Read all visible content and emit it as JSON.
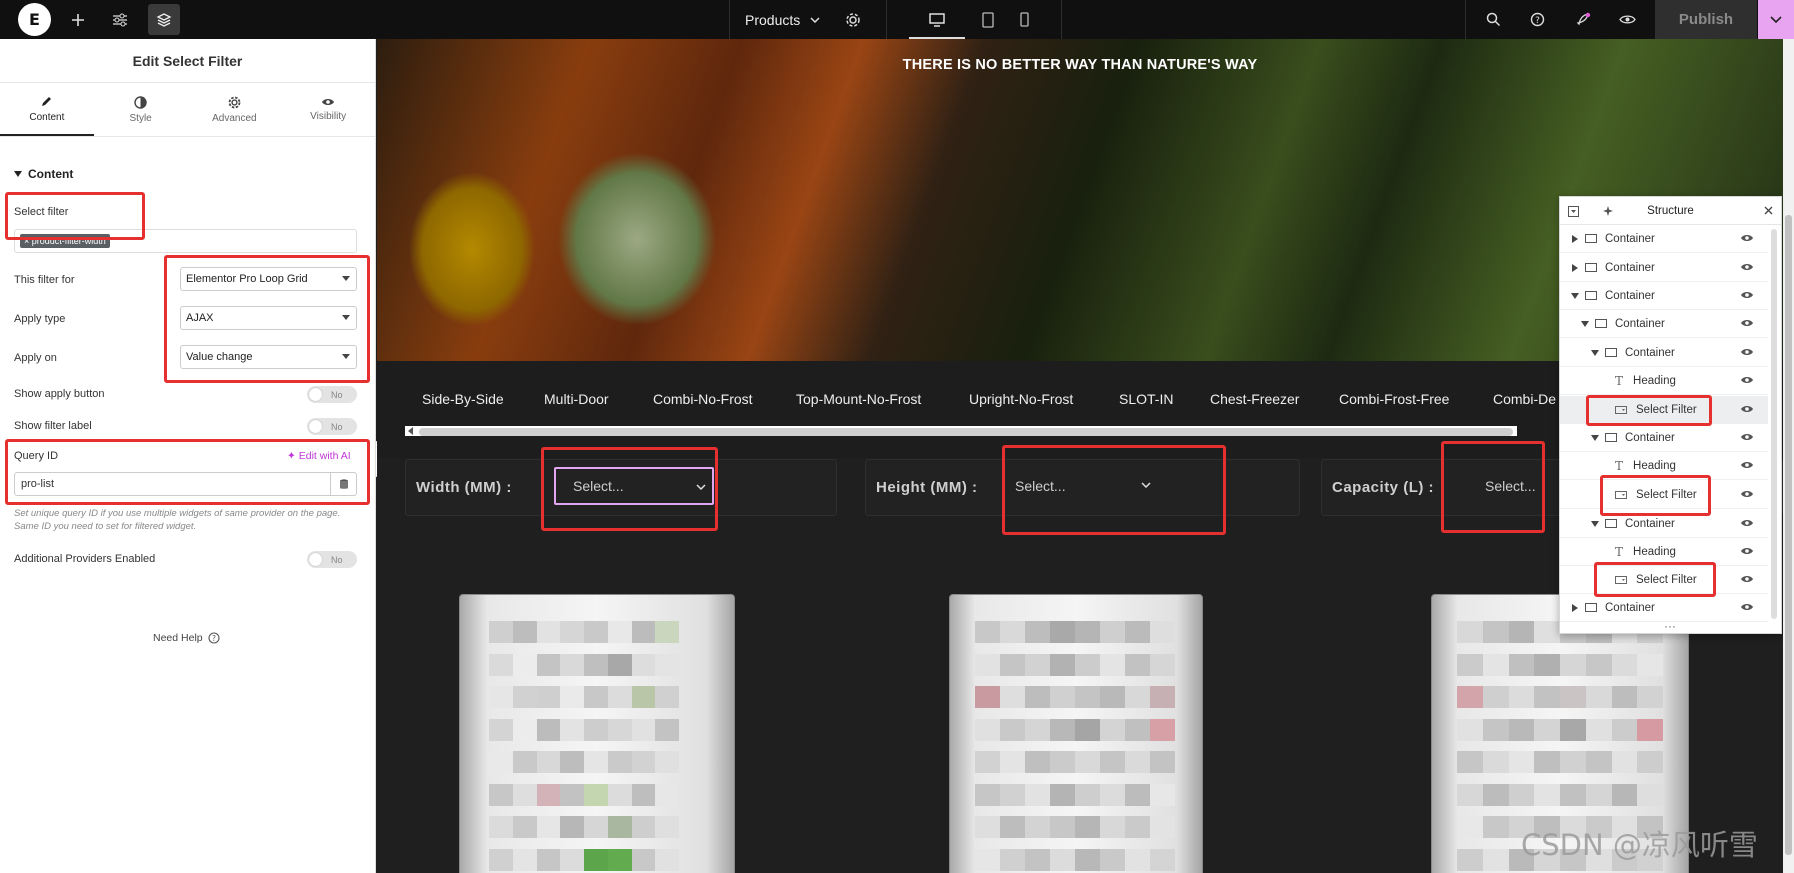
{
  "topbar": {
    "logo_letter": "E",
    "document_name": "Products",
    "publish_label": "Publish",
    "icons": [
      "plus-icon",
      "sliders-icon",
      "layers-icon",
      "chevron-down-icon",
      "gear-icon",
      "desktop-icon",
      "tablet-icon",
      "mobile-icon",
      "search-icon",
      "help-icon",
      "rocket-icon",
      "eye-icon"
    ]
  },
  "panel": {
    "title": "Edit Select Filter",
    "tabs": [
      {
        "label": "Content",
        "icon": "pencil-icon"
      },
      {
        "label": "Style",
        "icon": "half-circle-icon"
      },
      {
        "label": "Advanced",
        "icon": "gear-icon"
      },
      {
        "label": "Visibility",
        "icon": "eye-icon"
      }
    ],
    "section": "Content",
    "select_filter_label": "Select filter",
    "select_filter_tag": "× product-filter-width",
    "filter_for_label": "This filter for",
    "filter_for_value": "Elementor Pro Loop Grid",
    "apply_type_label": "Apply type",
    "apply_type_value": "AJAX",
    "apply_on_label": "Apply on",
    "apply_on_value": "Value change",
    "show_apply_label": "Show apply button",
    "show_apply_value": "No",
    "show_filter_label_label": "Show filter label",
    "show_filter_label_value": "No",
    "query_id_label": "Query ID",
    "edit_with_ai": "Edit with AI",
    "query_id_value": "pro-list",
    "query_note": "Set unique query ID if you use multiple widgets of same provider on the page. Same ID you need to set for filtered widget.",
    "additional_label": "Additional Providers Enabled",
    "additional_value": "No",
    "need_help": "Need Help"
  },
  "canvas": {
    "hero_title": "THERE IS NO BETTER WAY THAN NATURE'S WAY",
    "nav_items": [
      "Side-By-Side",
      "Multi-Door",
      "Combi-No-Frost",
      "Top-Mount-No-Frost",
      "Upright-No-Frost",
      "SLOT-IN",
      "Chest-Freezer",
      "Combi-Frost-Free",
      "Combi-De"
    ],
    "filters": [
      {
        "label": "Width  (MM)  :",
        "placeholder": "Select..."
      },
      {
        "label": "Height  (MM)  :",
        "placeholder": "Select..."
      },
      {
        "label": "Capacity  (L)  :",
        "placeholder": "Select..."
      }
    ]
  },
  "structure": {
    "title": "Structure",
    "rows": [
      {
        "label": "Container"
      },
      {
        "label": "Container"
      },
      {
        "label": "Container"
      },
      {
        "label": "Container"
      },
      {
        "label": "Container"
      },
      {
        "label": "Heading"
      },
      {
        "label": "Select Filter"
      },
      {
        "label": "Container"
      },
      {
        "label": "Heading"
      },
      {
        "label": "Select Filter"
      },
      {
        "label": "Container"
      },
      {
        "label": "Heading"
      },
      {
        "label": "Select Filter"
      },
      {
        "label": "Container"
      }
    ],
    "more": "···"
  },
  "watermark": "CSDN @凉风听雪",
  "colors": {
    "accent": "#c036d8",
    "highlight_red": "#e5302f",
    "topbar": "#101010",
    "publish_arrow": "#e8a4f1"
  }
}
